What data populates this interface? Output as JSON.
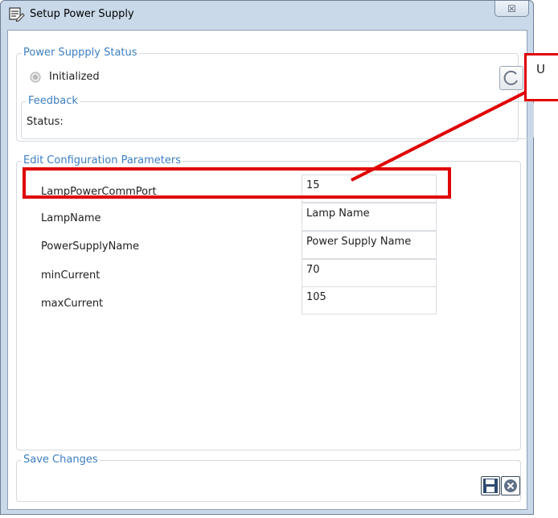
{
  "window": {
    "title": "Setup Power Supply",
    "close_glyph": "☒"
  },
  "status_group": {
    "legend": "Power Suppply Status",
    "status_label": "Initialized",
    "refresh_icon": "refresh-icon"
  },
  "feedback_group": {
    "legend": "Feedback",
    "status_label": "Status:"
  },
  "config_group": {
    "legend": "Edit Configuration Parameters",
    "rows": [
      {
        "label": "LampPowerCommPort",
        "value": "15"
      },
      {
        "label": "LampName",
        "value": "Lamp Name"
      },
      {
        "label": "PowerSupplyName",
        "value": "Power Supply Name"
      },
      {
        "label": "minCurrent",
        "value": "70"
      },
      {
        "label": "maxCurrent",
        "value": "105"
      }
    ]
  },
  "save_group": {
    "legend": "Save Changes",
    "save_icon": "save-icon",
    "cancel_icon": "cancel-icon"
  },
  "annotation": {
    "callout_text": "U",
    "highlight_color": "#e00000"
  },
  "colors": {
    "accent": "#3c7fc0",
    "window_frame": "#c9d9ea"
  }
}
